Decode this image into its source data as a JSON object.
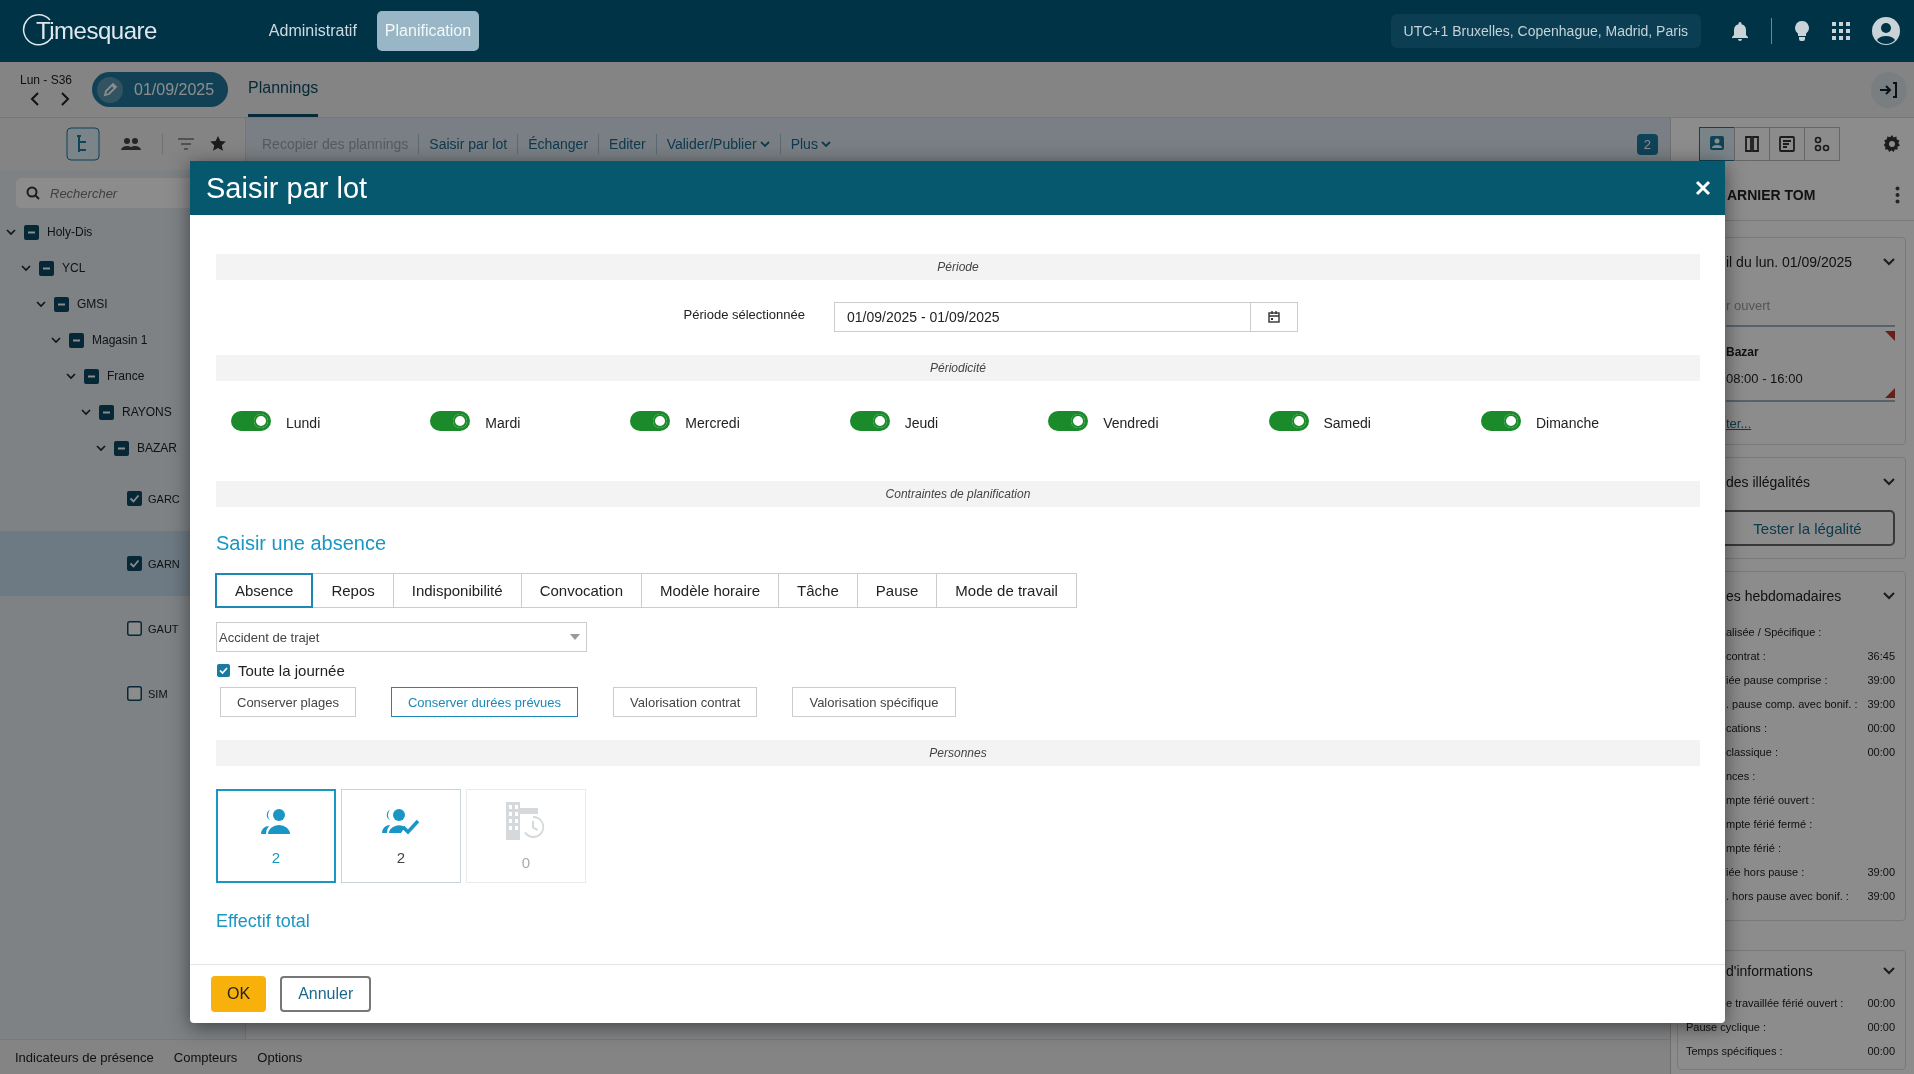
{
  "top_bar": {
    "logo": "Timesquare",
    "nav": [
      {
        "label": "Administratif",
        "selected": false
      },
      {
        "label": "Planification",
        "selected": true
      }
    ],
    "timezone": "UTC+1 Bruxelles, Copenhague, Madrid, Paris"
  },
  "date_bar": {
    "week": "Lun - S36",
    "date": "01/09/2025",
    "tabs": [
      {
        "label": "Plannings",
        "selected": true
      }
    ]
  },
  "toolbar": {
    "actions": [
      {
        "label": "Recopier des plannings",
        "disabled": true,
        "dropdown": false
      },
      {
        "label": "Saisir par lot",
        "disabled": false,
        "dropdown": false
      },
      {
        "label": "Échanger",
        "disabled": false,
        "dropdown": false
      },
      {
        "label": "Editer",
        "disabled": false,
        "dropdown": false
      },
      {
        "label": "Valider/Publier",
        "disabled": false,
        "dropdown": true
      },
      {
        "label": "Plus",
        "disabled": false,
        "dropdown": true
      }
    ],
    "badge": "2"
  },
  "sidebar": {
    "views": [
      {
        "selected": true
      },
      {
        "selected": false
      }
    ],
    "search": {
      "placeholder": "Rechercher"
    },
    "tree": [
      {
        "label": "Holy-Dis",
        "expanded": true,
        "checked": false,
        "partial": true,
        "selected": false,
        "children": [
          {
            "label": "YCL",
            "expanded": true,
            "checked": false,
            "partial": true,
            "selected": false,
            "children": [
              {
                "label": "GMSI",
                "expanded": true,
                "checked": false,
                "partial": true,
                "selected": false,
                "children": [
                  {
                    "label": "Magasin 1",
                    "expanded": true,
                    "checked": false,
                    "partial": true,
                    "selected": false,
                    "children": [
                      {
                        "label": "France",
                        "expanded": true,
                        "checked": false,
                        "partial": true,
                        "selected": false,
                        "children": [
                          {
                            "label": "RAYONS",
                            "expanded": true,
                            "checked": false,
                            "partial": true,
                            "selected": false,
                            "children": [
                              {
                                "label": "BAZAR",
                                "expanded": true,
                                "checked": false,
                                "partial": true,
                                "selected": false,
                                "children": [
                                  {
                                    "label": "GARC",
                                    "checked": true,
                                    "selected": false
                                  },
                                  {
                                    "label": "GARN",
                                    "checked": true,
                                    "selected": true
                                  },
                                  {
                                    "label": "GAUT",
                                    "checked": false,
                                    "selected": false
                                  },
                                  {
                                    "label": "SIM",
                                    "checked": false,
                                    "selected": false
                                  }
                                ]
                              }
                            ]
                          }
                        ]
                      }
                    ]
                  }
                ]
              }
            ]
          }
        ]
      }
    ]
  },
  "bottom_tabs": [
    "Indicateurs de présence",
    "Compteurs",
    "Options"
  ],
  "right_panel": {
    "views": [
      {
        "selected": true
      },
      {
        "selected": false
      },
      {
        "selected": false
      },
      {
        "selected": false
      }
    ],
    "employee": "ARNIER TOM",
    "day": {
      "title": "il du lun. 01/09/2025",
      "status": "r ouvert",
      "shift": "Bazar",
      "hours": "08:00 - 16:00",
      "link": "ter..."
    },
    "legality": {
      "title": "des illégalités",
      "button": "Tester la légalité"
    },
    "weekly": {
      "title": "es hebdomadaires",
      "rows": [
        {
          "label": "alisée / Spécifique :"
        },
        {
          "label": "contrat :",
          "value": "36:45"
        },
        {
          "label": "iée pause comprise :",
          "value": "39:00"
        },
        {
          "label": ". pause comp. avec bonif. :",
          "value": "39:00"
        },
        {
          "label": "cations :",
          "value": "00:00"
        },
        {
          "label": "classique :",
          "value": "00:00"
        },
        {
          "label": "nces :"
        },
        {
          "label": "mpte férié ouvert :"
        },
        {
          "label": "mpte férié fermé :"
        },
        {
          "label": "mpte férié :"
        },
        {
          "label": "iée hors pause :",
          "value": "39:00"
        },
        {
          "label": ". hors pause avec bonif. :",
          "value": "39:00"
        }
      ]
    },
    "info": {
      "title": "d'informations",
      "rows": [
        {
          "label": "e travaillée férié ouvert :",
          "value": "00:00"
        },
        {
          "label": "Pause cyclique :",
          "value": "00:00"
        },
        {
          "label": "Temps spécifiques :",
          "value": "00:00"
        }
      ]
    }
  },
  "dialog": {
    "title": "Saisir par lot",
    "period": {
      "heading": "Période",
      "label": "Période sélectionnée",
      "value": "01/09/2025 - 01/09/2025"
    },
    "periodicity": {
      "heading": "Périodicité",
      "days": [
        {
          "label": "Lundi",
          "on": true
        },
        {
          "label": "Mardi",
          "on": true
        },
        {
          "label": "Mercredi",
          "on": true
        },
        {
          "label": "Jeudi",
          "on": true
        },
        {
          "label": "Vendredi",
          "on": true
        },
        {
          "label": "Samedi",
          "on": true
        },
        {
          "label": "Dimanche",
          "on": true
        }
      ]
    },
    "constraints": {
      "heading": "Contraintes de planification",
      "subtitle": "Saisir une absence",
      "types": [
        {
          "label": "Absence",
          "selected": true
        },
        {
          "label": "Repos",
          "selected": false
        },
        {
          "label": "Indisponibilité",
          "selected": false
        },
        {
          "label": "Convocation",
          "selected": false
        },
        {
          "label": "Modèle horaire",
          "selected": false
        },
        {
          "label": "Tâche",
          "selected": false
        },
        {
          "label": "Pause",
          "selected": false
        },
        {
          "label": "Mode de travail",
          "selected": false
        }
      ],
      "reason": "Accident de trajet",
      "all_day": {
        "label": "Toute la journée",
        "checked": true
      },
      "modes": [
        {
          "label": "Conserver plages",
          "selected": false
        },
        {
          "label": "Conserver durées prévues",
          "selected": true
        },
        {
          "label": "Valorisation contrat",
          "selected": false
        },
        {
          "label": "Valorisation spécifique",
          "selected": false
        }
      ]
    },
    "people": {
      "heading": "Personnes",
      "cards": [
        {
          "kind": "people",
          "count": "2",
          "selected": true,
          "disabled": false
        },
        {
          "kind": "people-check",
          "count": "2",
          "selected": false,
          "disabled": false
        },
        {
          "kind": "building-clock",
          "count": "0",
          "selected": false,
          "disabled": true
        }
      ],
      "caption": "Effectif total"
    },
    "buttons": [
      {
        "label": "OK",
        "kind": "primary"
      },
      {
        "label": "Annuler",
        "kind": "secondary"
      }
    ]
  }
}
